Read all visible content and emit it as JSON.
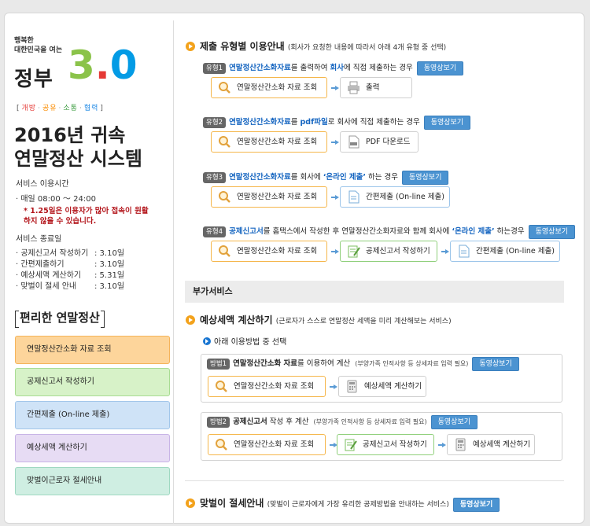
{
  "logo": {
    "small1": "행복한",
    "small2": "대한민국을 여는",
    "jeongbu": "정부",
    "three": "3",
    "dot": ".",
    "zero": "0",
    "tags": [
      {
        "t": "[",
        "c": "#555"
      },
      {
        "t": "개방",
        "c": "#e53935"
      },
      {
        "t": "·",
        "c": "#999"
      },
      {
        "t": "공유",
        "c": "#fb8c00"
      },
      {
        "t": "·",
        "c": "#999"
      },
      {
        "t": "소통",
        "c": "#43a047"
      },
      {
        "t": "·",
        "c": "#999"
      },
      {
        "t": "협력",
        "c": "#1e88e5"
      },
      {
        "t": "]",
        "c": "#555"
      }
    ]
  },
  "left": {
    "title1": "2016년 귀속",
    "title2": "연말정산 시스템",
    "svc_time_label": "서비스 이용시간",
    "svc_time_value": "· 매일 08:00 ～ 24:00",
    "warn1": "* 1.25일은 이용자가 많아 접속이 원활",
    "warn2": "하지 않을 수 있습니다.",
    "end_label": "서비스 종료일",
    "end_rows": [
      {
        "k": "· 공제신고서 작성하기",
        "v": ": 3.10일"
      },
      {
        "k": "· 간편제출하기",
        "v": ": 3.10일"
      },
      {
        "k": "· 예상세액 계산하기",
        "v": ": 5.31일"
      },
      {
        "k": "· 맞벌이 절세 안내",
        "v": ": 3.10일"
      }
    ],
    "conv_label": "편리한 연말정산",
    "menu": [
      {
        "label": "연말정산간소화 자료 조회",
        "bg": "#fdd59b",
        "bd": "#f5b45a"
      },
      {
        "label": "공제신고서 작성하기",
        "bg": "#d7f2c8",
        "bd": "#a9dc93"
      },
      {
        "label": "간편제출 (On-line 제출)",
        "bg": "#cfe3f7",
        "bd": "#a2c6ea"
      },
      {
        "label": "예상세액 계산하기",
        "bg": "#e7dcf4",
        "bd": "#c8b4e6"
      },
      {
        "label": "맞벌이근로자 절세안내",
        "bg": "#cfeee2",
        "bd": "#9fd8c1"
      }
    ]
  },
  "right": {
    "s1_title": "제출 유형별 이용안내",
    "s1_sub": "(회사가 요청한 내용에 따라서 아래 4개 유형 중 선택)",
    "video": "동영상보기",
    "types": [
      {
        "badge": "유형1",
        "p1": "연말정산간소화자료",
        "p2": "를 출력하여 ",
        "p3": "회사",
        "p4": "에 직접 제출하는 경우",
        "boxes": [
          {
            "label": "연말정산간소화 자료 조회",
            "cls": "or",
            "icon": "magnifier-icon"
          },
          {
            "label": "출력",
            "cls": "",
            "icon": "printer-icon"
          }
        ]
      },
      {
        "badge": "유형2",
        "p1": "연말정산간소화자료",
        "p2": "를 ",
        "p3": "pdf파일",
        "p4": "로 회사에 직접 제출하는 경우",
        "boxes": [
          {
            "label": "연말정산간소화 자료 조회",
            "cls": "or",
            "icon": "magnifier-icon"
          },
          {
            "label": "PDF 다운로드",
            "cls": "",
            "icon": "pdf-file-icon"
          }
        ]
      },
      {
        "badge": "유형3",
        "p1": "연말정산간소화자료",
        "p2": "를 회사에 ",
        "p3": "‘온라인 제출’",
        "p4": " 하는 경우",
        "boxes": [
          {
            "label": "연말정산간소화 자료 조회",
            "cls": "or",
            "icon": "magnifier-icon"
          },
          {
            "label": "간편제출 (On-line 제출)",
            "cls": "bl",
            "icon": "document-icon"
          }
        ]
      },
      {
        "badge": "유형4",
        "p1": "공제신고서",
        "p2": "를 홈택스에서 작성한 후 연말정산간소화자료와 함께 회사에 ",
        "p3": "‘온라인 제출’",
        "p4": " 하는경우",
        "boxes": [
          {
            "label": "연말정산간소화 자료 조회",
            "cls": "or",
            "icon": "magnifier-icon"
          },
          {
            "label": "공제신고서 작성하기",
            "cls": "gr",
            "icon": "form-icon"
          },
          {
            "label": "간편제출 (On-line 제출)",
            "cls": "bl",
            "icon": "document-icon"
          }
        ]
      }
    ],
    "extra_bar": "부가서비스",
    "s2_title": "예상세액 계산하기",
    "s2_sub": "(근로자가 스스로 연말정산 세액을 미리 계산해보는 서비스)",
    "s2_choose": "아래 이용방법 중 선택",
    "methods": [
      {
        "badge": "방법1",
        "p1": "연말정산간소화 자료",
        "p2": "를 이용하여 계산",
        "p3": "(부양가족 인적사항 등 상세자료 입력 필요)",
        "boxes": [
          {
            "label": "연말정산간소화 자료 조회",
            "cls": "or",
            "icon": "magnifier-icon"
          },
          {
            "label": "예상세액 계산하기",
            "cls": "",
            "icon": "calculator-icon"
          }
        ]
      },
      {
        "badge": "방법2",
        "p1": "공제신고서",
        "p2": " 작성 후 계산",
        "p3": "(부양가족 인적사항 등 상세자료 입력 필요)",
        "boxes": [
          {
            "label": "연말정산간소화 자료 조회",
            "cls": "or",
            "icon": "magnifier-icon"
          },
          {
            "label": "공제신고서 작성하기",
            "cls": "gr",
            "icon": "form-icon"
          },
          {
            "label": "예상세액 계산하기",
            "cls": "",
            "icon": "calculator-icon"
          }
        ]
      }
    ],
    "s3_title": "맞벌이 절세안내",
    "s3_sub": "(맞벌이 근로자에게 가장 유리한 공제방법을 안내하는 서비스)"
  }
}
